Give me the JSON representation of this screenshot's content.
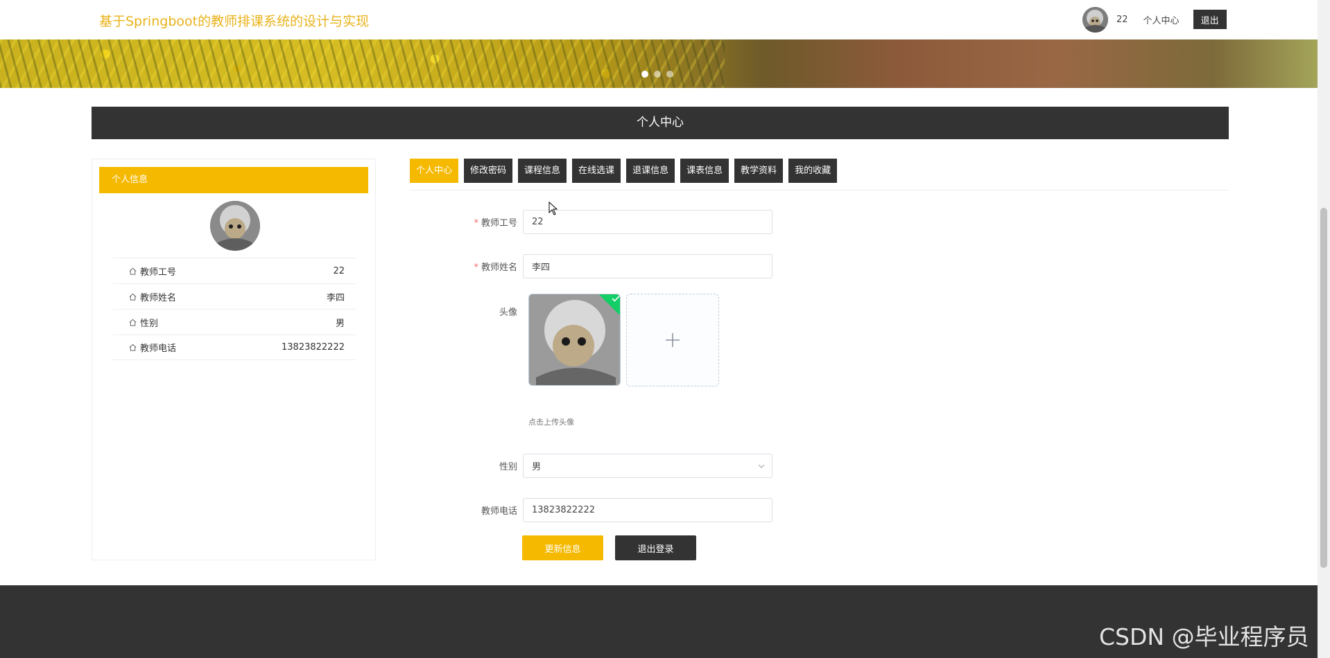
{
  "header": {
    "site_title": "基于Springboot的教师排课系统的设计与实现",
    "username": "22",
    "profile_link": "个人中心",
    "logout": "退出"
  },
  "section": {
    "title": "个人中心"
  },
  "left_panel": {
    "title": "个人信息",
    "rows": [
      {
        "label": "教师工号",
        "value": "22"
      },
      {
        "label": "教师姓名",
        "value": "李四"
      },
      {
        "label": "性别",
        "value": "男"
      },
      {
        "label": "教师电话",
        "value": "13823822222"
      }
    ]
  },
  "tabs": [
    {
      "label": "个人中心",
      "active": true
    },
    {
      "label": "修改密码"
    },
    {
      "label": "课程信息"
    },
    {
      "label": "在线选课"
    },
    {
      "label": "退课信息"
    },
    {
      "label": "课表信息"
    },
    {
      "label": "教学资料"
    },
    {
      "label": "我的收藏"
    }
  ],
  "form": {
    "teacher_id_label": "教师工号",
    "teacher_id_value": "22",
    "teacher_name_label": "教师姓名",
    "teacher_name_value": "李四",
    "avatar_label": "头像",
    "upload_tip": "点击上传头像",
    "gender_label": "性别",
    "gender_value": "男",
    "phone_label": "教师电话",
    "phone_value": "13823822222",
    "update_button": "更新信息",
    "logout_button": "退出登录"
  },
  "footer": {
    "watermark": "CSDN @毕业程序员"
  },
  "colors": {
    "accent": "#f5b900",
    "dark": "#333333",
    "title": "#e9b21a"
  }
}
